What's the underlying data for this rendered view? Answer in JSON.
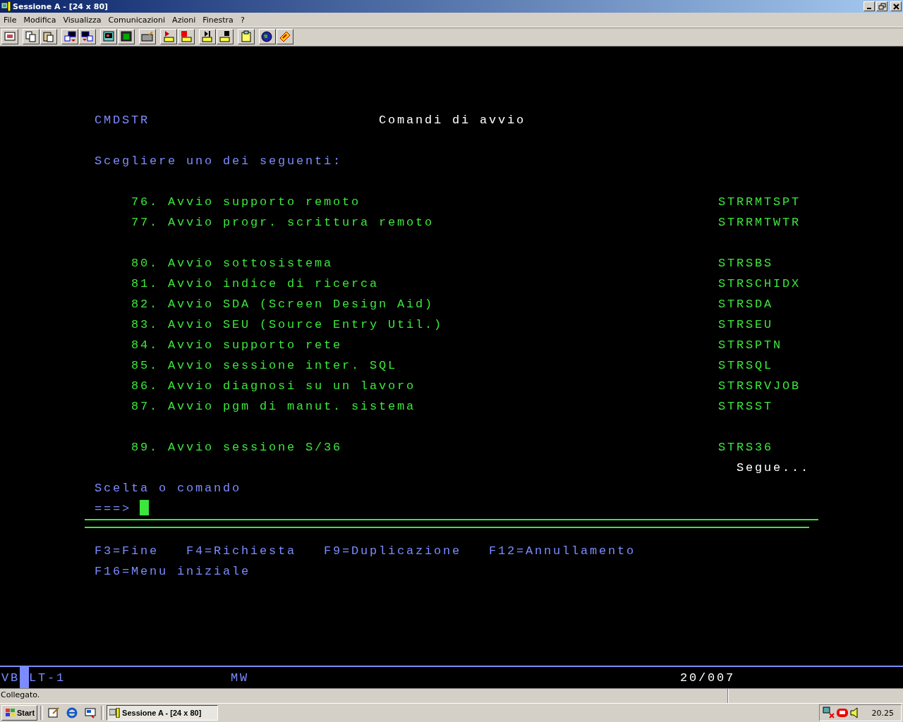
{
  "window": {
    "title": "Sessione A - [24 x 80]"
  },
  "menu": [
    "File",
    "Modifica",
    "Visualizza",
    "Comunicazioni",
    "Azioni",
    "Finestra",
    "?"
  ],
  "screen": {
    "program": "CMDSTR",
    "title": "Comandi di avvio",
    "instruction": "Scegliere uno dei seguenti:",
    "option_groups": [
      [
        {
          "number": "76.",
          "label": "Avvio supporto remoto",
          "command": "STRRMTSPT"
        },
        {
          "number": "77.",
          "label": "Avvio progr. scrittura remoto",
          "command": "STRRMTWTR"
        }
      ],
      [
        {
          "number": "80.",
          "label": "Avvio sottosistema",
          "command": "STRSBS"
        },
        {
          "number": "81.",
          "label": "Avvio indice di ricerca",
          "command": "STRSCHIDX"
        },
        {
          "number": "82.",
          "label": "Avvio SDA (Screen Design Aid)",
          "command": "STRSDA"
        },
        {
          "number": "83.",
          "label": "Avvio SEU (Source Entry Util.)",
          "command": "STRSEU"
        },
        {
          "number": "84.",
          "label": "Avvio supporto rete",
          "command": "STRSPTN"
        },
        {
          "number": "85.",
          "label": "Avvio sessione inter. SQL",
          "command": "STRSQL"
        },
        {
          "number": "86.",
          "label": "Avvio diagnosi su un lavoro",
          "command": "STRSRVJOB"
        },
        {
          "number": "87.",
          "label": "Avvio pgm di manut. sistema",
          "command": "STRSST"
        }
      ],
      [
        {
          "number": "89.",
          "label": "Avvio sessione S/36",
          "command": "STRS36"
        }
      ]
    ],
    "more": "Segue...",
    "prompt_label": "Scelta o comando",
    "prompt": "===>",
    "function_key_rows": [
      [
        "F3=Fine",
        "F4=Richiesta",
        "F9=Duplicazione",
        "F12=Annullamento"
      ],
      [
        "F16=Menu iniziale"
      ]
    ]
  },
  "oia": {
    "left_a": "VB",
    "left_b": "LT-1",
    "middle": "MW",
    "position": "20/007"
  },
  "status_bar": "Collegato.",
  "taskbar": {
    "start": "Start",
    "task": "Sessione A - [24 x 80]",
    "clock": "20.25"
  }
}
